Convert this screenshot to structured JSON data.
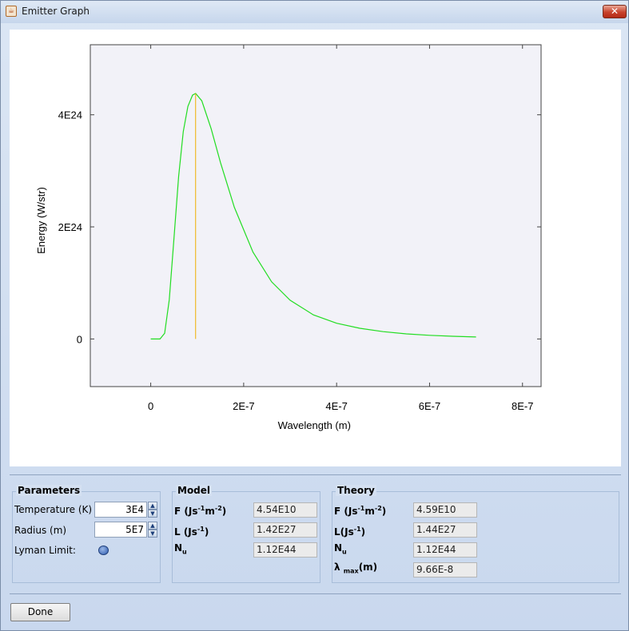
{
  "window": {
    "title": "Emitter Graph",
    "close_glyph": "✕",
    "app_icon": "java-cup-icon"
  },
  "chart_data": {
    "type": "line",
    "xlabel": "Wavelength (m)",
    "ylabel": "Energy (W/str)",
    "xlim": [
      -1.3e-07,
      8.4e-07
    ],
    "ylim": [
      -8.5e+23,
      5.25e+24
    ],
    "x_ticks": [
      {
        "value": 0,
        "label": "0"
      },
      {
        "value": 2e-07,
        "label": "2E-7"
      },
      {
        "value": 4e-07,
        "label": "4E-7"
      },
      {
        "value": 6e-07,
        "label": "6E-7"
      },
      {
        "value": 8e-07,
        "label": "8E-7"
      }
    ],
    "y_ticks": [
      {
        "value": 0,
        "label": "0"
      },
      {
        "value": 2e+24,
        "label": "2E24"
      },
      {
        "value": 4e+24,
        "label": "4E24"
      }
    ],
    "series": [
      {
        "color": "#22dd22",
        "x": [
          0,
          2e-08,
          3e-08,
          4e-08,
          5e-08,
          6e-08,
          7e-08,
          8e-08,
          9e-08,
          9.66e-08,
          1.1e-07,
          1.3e-07,
          1.5e-07,
          1.8e-07,
          2.2e-07,
          2.6e-07,
          3e-07,
          3.5e-07,
          4e-07,
          4.5e-07,
          5e-07,
          5.5e-07,
          6e-07,
          6.5e-07,
          7e-07
        ],
        "y": [
          0,
          0,
          1e+23,
          7e+23,
          1.8e+24,
          2.9e+24,
          3.7e+24,
          4.15e+24,
          4.35e+24,
          4.38e+24,
          4.25e+24,
          3.75e+24,
          3.15e+24,
          2.35e+24,
          1.55e+24,
          1.02e+24,
          6.9e+23,
          4.3e+23,
          2.8e+23,
          1.9e+23,
          1.3e+23,
          9e+22,
          6.5e+22,
          4.8e+22,
          3.5e+22
        ]
      }
    ],
    "marker": {
      "x": 9.66e-08,
      "y_top": 4.38e+24,
      "color": "#f0b000"
    },
    "grid": false
  },
  "parameters": {
    "title": "Parameters",
    "temperature_label": "Temperature (K)",
    "temperature_value": "3E4",
    "radius_label": "Radius (m)",
    "radius_value": "5E7",
    "lyman_label": "Lyman Limit:"
  },
  "model": {
    "title": "Model",
    "f_value": "4.54E10",
    "l_value": "1.42E27",
    "nu_value": "1.12E44"
  },
  "theory": {
    "title": "Theory",
    "f_value": "4.59E10",
    "l_value": "1.44E27",
    "nu_value": "1.12E44",
    "lmax_value": "9.66E-8"
  },
  "done_label": "Done"
}
